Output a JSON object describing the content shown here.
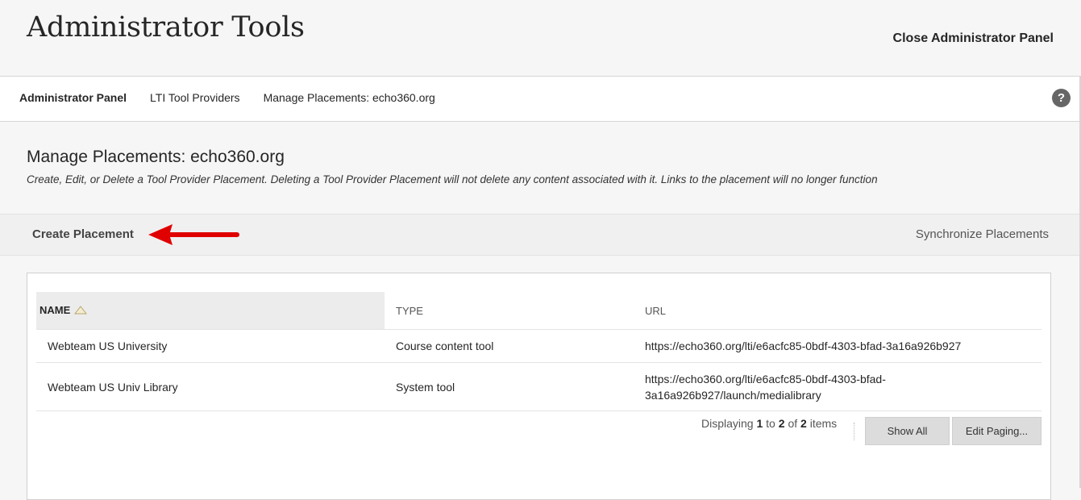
{
  "header": {
    "title": "Administrator Tools",
    "close_label": "Close Administrator Panel"
  },
  "breadcrumb": {
    "items": [
      {
        "label": "Administrator Panel"
      },
      {
        "label": "LTI Tool Providers"
      },
      {
        "label": "Manage Placements: echo360.org"
      }
    ],
    "help_icon": "question-mark-icon"
  },
  "section": {
    "title": "Manage Placements: echo360.org",
    "description": "Create, Edit, or Delete a Tool Provider Placement. Deleting a Tool Provider Placement will not delete any content associated with it. Links to the placement will no longer function"
  },
  "actions": {
    "create_label": "Create Placement",
    "sync_label": "Synchronize Placements",
    "annotation_arrow_color": "#e00000"
  },
  "table": {
    "columns": [
      {
        "label": "NAME"
      },
      {
        "label": "TYPE"
      },
      {
        "label": "URL"
      }
    ],
    "rows": [
      {
        "name": "Webteam US University",
        "type": "Course content tool",
        "url": "https://echo360.org/lti/e6acfc85-0bdf-4303-bfad-3a16a926b927"
      },
      {
        "name": "Webteam US Univ Library",
        "type": "System tool",
        "url_line1": "https://echo360.org/lti/e6acfc85-0bdf-4303-bfad-",
        "url_line2": "3a16a926b927/launch/medialibrary"
      }
    ]
  },
  "paging": {
    "prefix": "Displaying",
    "from": "1",
    "to_word": "to",
    "to": "2",
    "of_word": "of",
    "total": "2",
    "suffix": "items",
    "show_all_label": "Show All",
    "edit_paging_label": "Edit Paging..."
  }
}
